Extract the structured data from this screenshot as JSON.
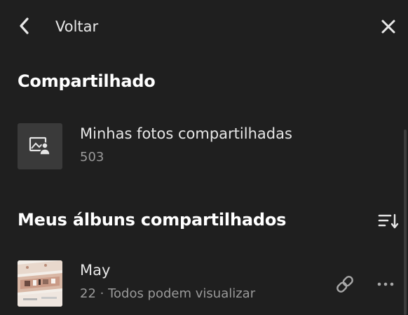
{
  "header": {
    "back_label": "Voltar"
  },
  "shared": {
    "title": "Compartilhado",
    "item": {
      "name": "Minhas fotos compartilhadas",
      "count": "503"
    }
  },
  "albums": {
    "title": "Meus álbuns compartilhados",
    "items": [
      {
        "name": "May",
        "meta": "22 · Todos podem visualizar"
      }
    ]
  },
  "icons": {
    "back": "chevron-left-icon",
    "close": "close-icon",
    "shared_photos": "image-person-icon",
    "sort": "sort-icon",
    "link": "link-icon",
    "more": "more-horizontal-icon"
  },
  "colors": {
    "background": "#1f1f1f",
    "text_primary": "#e6e6e6",
    "text_secondary": "#9a9a9a",
    "tile": "#3a3a3a"
  }
}
